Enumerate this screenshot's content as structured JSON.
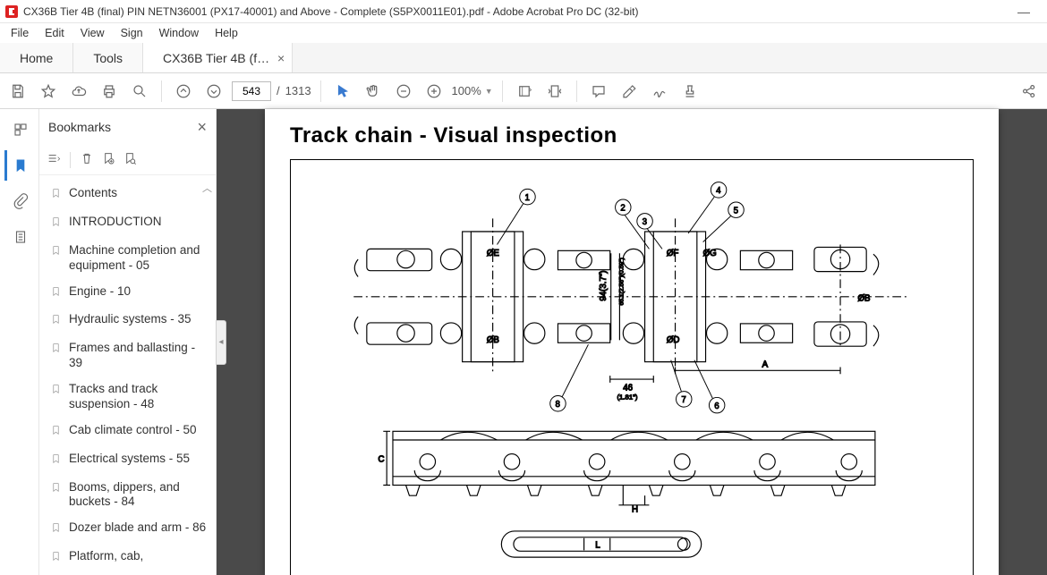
{
  "window": {
    "title": "CX36B Tier 4B (final) PIN NETN36001 (PX17-40001) and Above - Complete (S5PX0011E01).pdf - Adobe Acrobat Pro DC (32-bit)"
  },
  "menu": {
    "file": "File",
    "edit": "Edit",
    "view": "View",
    "sign": "Sign",
    "window": "Window",
    "help": "Help"
  },
  "tabs": {
    "home": "Home",
    "tools": "Tools",
    "doc": "CX36B Tier 4B (final..."
  },
  "toolbar": {
    "currentPage": "543",
    "totalPages": "1313",
    "pageSep": "/",
    "zoom": "100%"
  },
  "sidebar": {
    "title": "Bookmarks",
    "items": [
      "Contents",
      "INTRODUCTION",
      "Machine completion and equipment - 05",
      "Engine - 10",
      "Hydraulic systems - 35",
      "Frames and ballasting - 39",
      "Tracks and track suspension - 48",
      "Cab climate control - 50",
      "Electrical systems - 55",
      "Booms, dippers, and buckets - 84",
      "Dozer blade and arm - 86",
      "Platform, cab,"
    ]
  },
  "document": {
    "heading": "Track chain - Visual inspection",
    "callouts": {
      "c1": "1",
      "c2": "2",
      "c3": "3",
      "c4": "4",
      "c5": "5",
      "c6": "6",
      "c7": "7",
      "c8": "8"
    },
    "labels": {
      "phiE": "ØE",
      "phiB": "ØB",
      "phiB2": "ØB",
      "phiF": "ØF",
      "phiD": "ØD",
      "phiG": "ØG",
      "dim94": "94(3.7\")",
      "dim651": "65.1(2.56\")(0.59\")",
      "dim46": "46",
      "dim181": "(1.81\")",
      "A": "A",
      "C": "C",
      "H": "H",
      "L": "L"
    }
  }
}
